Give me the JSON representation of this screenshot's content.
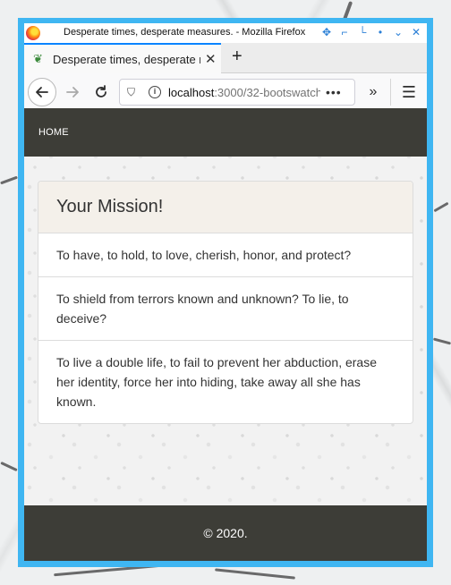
{
  "window": {
    "title": "Desperate times, desperate measures. - Mozilla Firefox"
  },
  "tab": {
    "label": "Desperate times, desperate measures.",
    "favicon": "leaf-icon",
    "close": "✕",
    "new_tab": "+"
  },
  "navbar": {
    "url_host": "localhost",
    "url_path": ":3000/32-bootswatch",
    "page_actions": "•••",
    "overflow": "»",
    "menu": "☰"
  },
  "site": {
    "nav_home": "HOME",
    "card_title": "Your Mission!",
    "items": [
      "To have, to hold, to love, cherish, honor, and protect?",
      "To shield from terrors known and unknown? To lie, to deceive?",
      "To live a double life, to fail to prevent her abduction, erase her identity, force her into hiding, take away all she has known."
    ],
    "footer": "© 2020."
  },
  "colors": {
    "window_border": "#3fb6f2",
    "site_nav_bg": "#3d3d37",
    "card_header_bg": "#f4f0ea",
    "tab_accent": "#0a84ff"
  }
}
